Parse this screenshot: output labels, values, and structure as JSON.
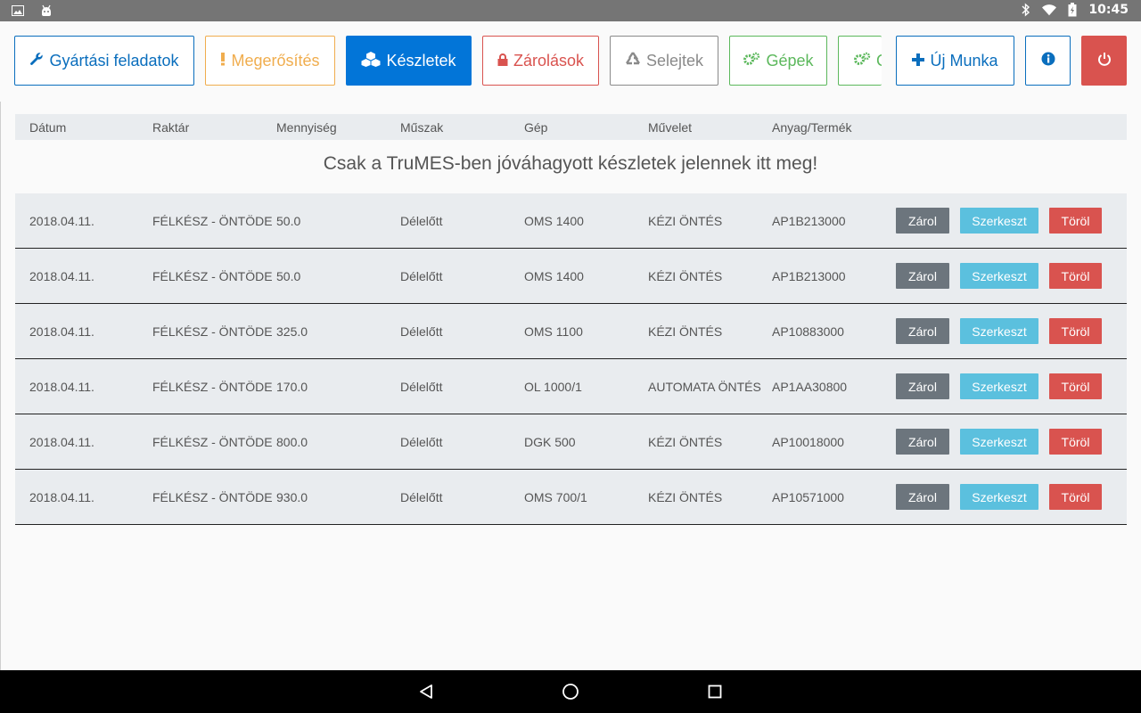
{
  "status_bar": {
    "time": "10:45",
    "left_icons": [
      "image-icon",
      "android-icon"
    ],
    "right_icons": [
      "bluetooth-icon",
      "wifi-icon",
      "battery-icon"
    ]
  },
  "toolbar": {
    "tasks_label": "Gyártási feladatok",
    "confirm_label": "Megerősítés",
    "stock_label": "Készletek",
    "locks_label": "Zárolások",
    "scrap_label": "Selejtek",
    "machines_label": "Gépek",
    "more_label": "G",
    "new_work_label": "Új Munka"
  },
  "colors": {
    "primary": "#0275d8",
    "warning": "#f0ad4e",
    "danger": "#d9534f",
    "success": "#5cb85c",
    "info": "#5bc0de",
    "secondary": "#6c757d"
  },
  "table": {
    "headers": [
      "Dátum",
      "Raktár",
      "Mennyiség",
      "Műszak",
      "Gép",
      "Művelet",
      "Anyag/Termék"
    ],
    "notice": "Csak a TruMES-ben jóváhagyott készletek jelennek itt meg!",
    "action_labels": {
      "lock": "Zárol",
      "edit": "Szerkeszt",
      "delete": "Töröl"
    },
    "rows": [
      [
        "2018.04.11.",
        "FÉLKÉSZ - ÖNTÖDE",
        "50.0",
        "Délelőtt",
        "OMS 1400",
        "KÉZI ÖNTÉS",
        "AP1B213000"
      ],
      [
        "2018.04.11.",
        "FÉLKÉSZ - ÖNTÖDE",
        "50.0",
        "Délelőtt",
        "OMS 1400",
        "KÉZI ÖNTÉS",
        "AP1B213000"
      ],
      [
        "2018.04.11.",
        "FÉLKÉSZ - ÖNTÖDE",
        "325.0",
        "Délelőtt",
        "OMS 1100",
        "KÉZI ÖNTÉS",
        "AP10883000"
      ],
      [
        "2018.04.11.",
        "FÉLKÉSZ - ÖNTÖDE",
        "170.0",
        "Délelőtt",
        "OL 1000/1",
        "AUTOMATA ÖNTÉS",
        "AP1AA30800"
      ],
      [
        "2018.04.11.",
        "FÉLKÉSZ - ÖNTÖDE",
        "800.0",
        "Délelőtt",
        "DGK 500",
        "KÉZI ÖNTÉS",
        "AP10018000"
      ],
      [
        "2018.04.11.",
        "FÉLKÉSZ - ÖNTÖDE",
        "930.0",
        "Délelőtt",
        "OMS 700/1",
        "KÉZI ÖNTÉS",
        "AP10571000"
      ]
    ]
  }
}
